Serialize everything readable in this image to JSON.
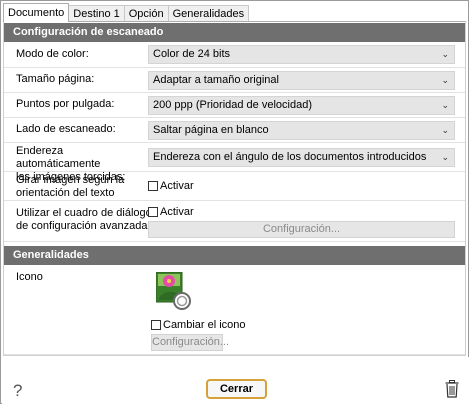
{
  "tabs": [
    {
      "label": "Documento"
    },
    {
      "label": "Destino 1"
    },
    {
      "label": "Opción"
    },
    {
      "label": "Generalidades"
    }
  ],
  "scan_section": {
    "title": "Configuración de escaneado",
    "color_mode": {
      "label": "Modo de color:",
      "value": "Color de 24 bits"
    },
    "page_size": {
      "label": "Tamaño página:",
      "value": "Adaptar a tamaño original"
    },
    "dpi": {
      "label": "Puntos por pulgada:",
      "value": "200 ppp (Prioridad de velocidad)"
    },
    "scan_side": {
      "label": "Lado de escaneado:",
      "value": "Saltar página en blanco"
    },
    "deskew": {
      "label_line1": "Endereza automáticamente",
      "label_line2": "las imágenes torcidas:",
      "value": "Endereza con el ángulo de los documentos introducidos"
    },
    "rotate": {
      "label_line1": "Girar imagen según la",
      "label_line2": "orientación del texto",
      "checkbox": "Activar"
    },
    "advanced": {
      "label_line1": "Utilizar el cuadro de diálogo",
      "label_line2": "de configuración avanzada",
      "checkbox": "Activar",
      "button": "Configuración..."
    }
  },
  "general_section": {
    "title": "Generalidades",
    "icon_label": "Icono",
    "change_icon": "Cambiar el icono",
    "button": "Configuración..."
  },
  "footer": {
    "help": "?",
    "close": "Cerrar"
  },
  "colors": {
    "header_bg": "#6f6f6f",
    "accent_border": "#d6a13a"
  }
}
